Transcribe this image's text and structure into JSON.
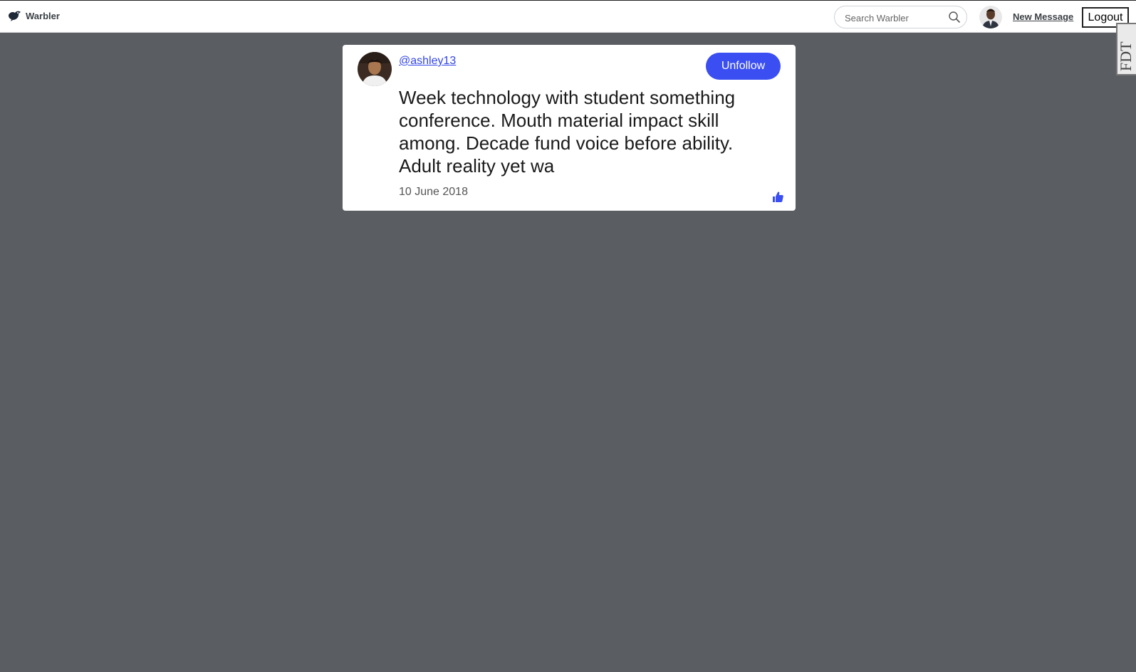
{
  "navbar": {
    "brand_name": "Warbler",
    "search_placeholder": "Search Warbler",
    "new_message_label": "New Message",
    "logout_label": "Logout",
    "side_tab_label": "FDT"
  },
  "message": {
    "username": "@ashley13",
    "follow_button_label": "Unfollow",
    "text": "Week technology with student something conference. Mouth material impact skill among. Decade fund voice before ability. Adult reality yet wa",
    "date": "10 June 2018"
  },
  "icons": {
    "brand": "bird-logo-icon",
    "search": "search-icon",
    "like": "thumbs-up-icon"
  },
  "colors": {
    "accent": "#3a4ef2",
    "link": "#3346e6",
    "page_background": "#5a5d62"
  }
}
